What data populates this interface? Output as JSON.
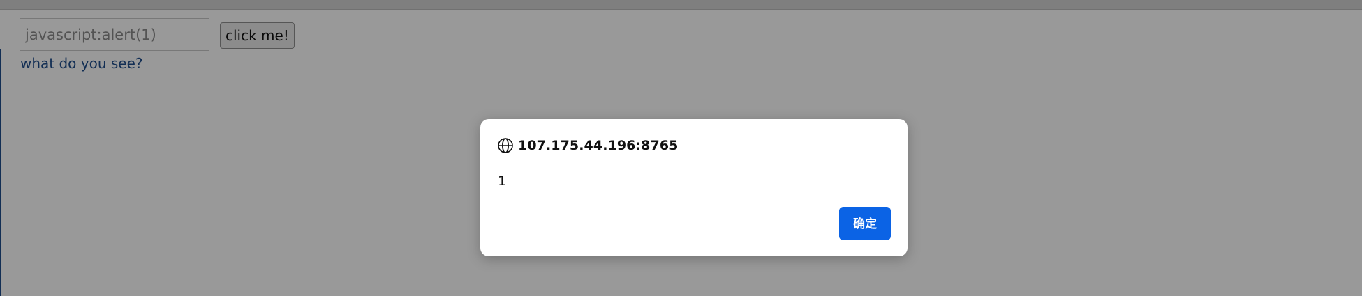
{
  "page": {
    "input_placeholder": "javascript:alert(1)",
    "button_label": "click me!",
    "prompt_text": "what do you see?"
  },
  "dialog": {
    "origin": "107.175.44.196:8765",
    "message": "1",
    "ok_label": "确定",
    "origin_icon": "globe-icon"
  },
  "colors": {
    "ok_button": "#0b63e5",
    "link_text": "#1f4e8c",
    "overlay": "rgba(0,0,0,0.4)"
  }
}
